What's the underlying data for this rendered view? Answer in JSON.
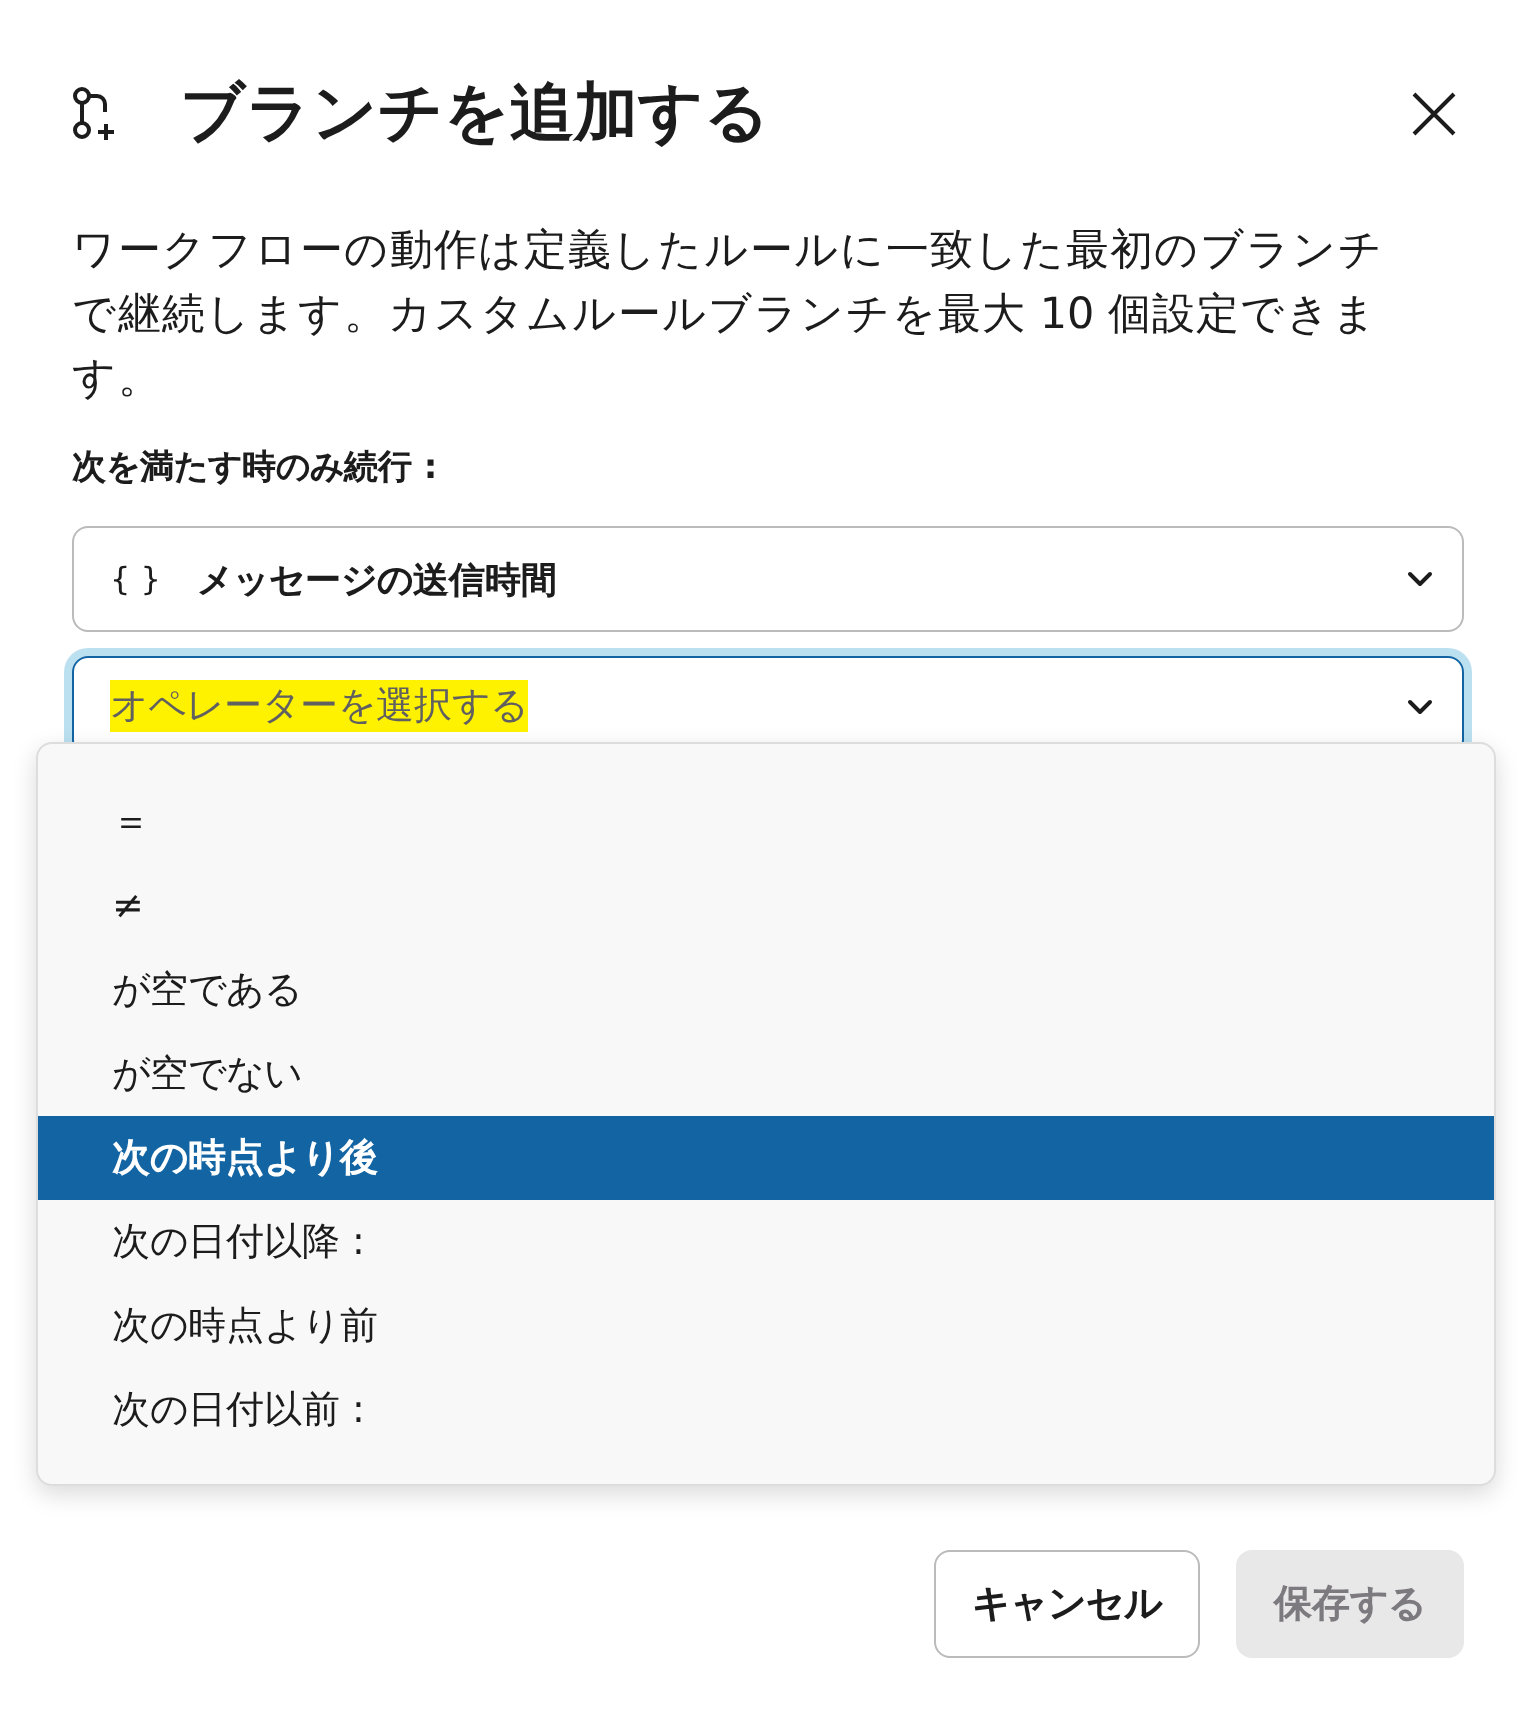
{
  "dialog": {
    "title": "ブランチを追加する",
    "description": "ワークフローの動作は定義したルールに一致した最初のブランチで継続します。カスタムルールブランチを最大 10 個設定できます。",
    "condition_label": "次を満たす時のみ続行 :",
    "variable_select": {
      "icon": "{ }",
      "value": "メッセージの送信時間"
    },
    "operator_select": {
      "placeholder": "オペレーターを選択する",
      "highlighted": true,
      "expanded": true,
      "options": [
        {
          "label": "＝",
          "selected": false
        },
        {
          "label": "≠",
          "selected": false
        },
        {
          "label": "が空である",
          "selected": false
        },
        {
          "label": "が空でない",
          "selected": false
        },
        {
          "label": "次の時点より後",
          "selected": true
        },
        {
          "label": "次の日付以降 :",
          "selected": false
        },
        {
          "label": "次の時点より前",
          "selected": false
        },
        {
          "label": "次の日付以前 :",
          "selected": false
        }
      ]
    },
    "buttons": [
      {
        "label": "キャンセル",
        "disabled": false
      },
      {
        "label": "保存する",
        "disabled": true
      }
    ]
  }
}
